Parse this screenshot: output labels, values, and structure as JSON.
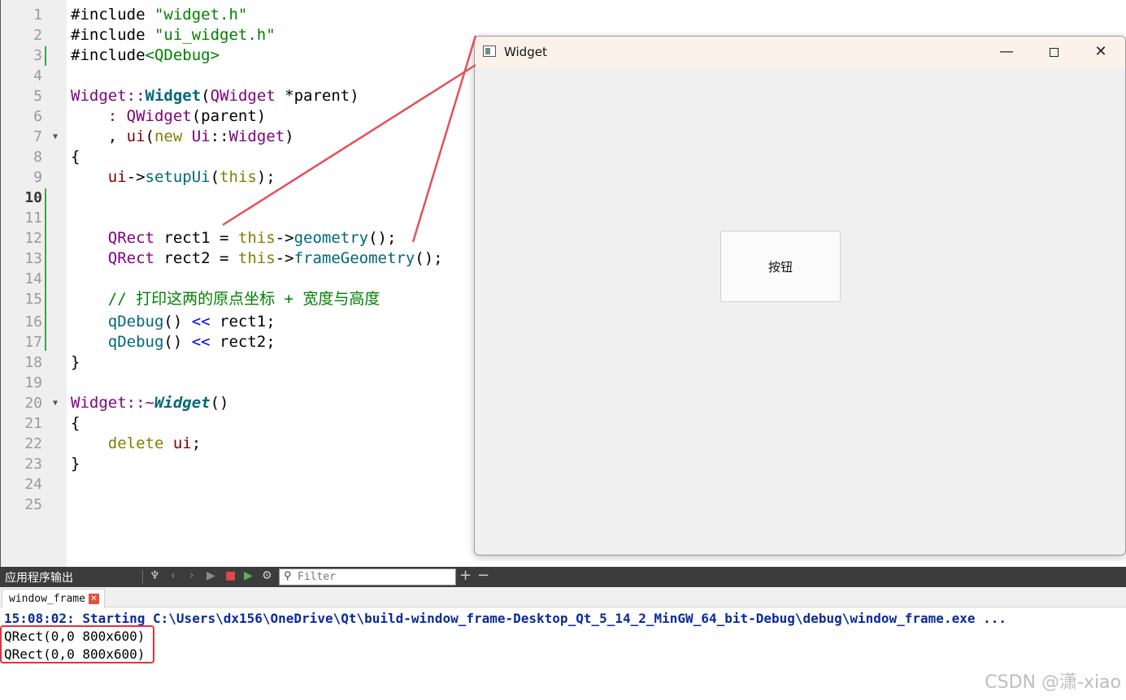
{
  "editor": {
    "line_numbers": [
      "1",
      "2",
      "3",
      "4",
      "5",
      "6",
      "7",
      "8",
      "9",
      "10",
      "11",
      "12",
      "13",
      "14",
      "15",
      "16",
      "17",
      "18",
      "19",
      "20",
      "21",
      "22",
      "23",
      "24",
      "25"
    ],
    "current_line": "10",
    "code": {
      "l1_kw": "#include",
      "l1_str": " \"widget.h\"",
      "l2_kw": "#include",
      "l2_str": " \"ui_widget.h\"",
      "l3_kw": "#include",
      "l3_str": "<QDebug>",
      "l5_a": "Widget",
      "l5_b": "::",
      "l5_c": "Widget",
      "l5_d": "(",
      "l5_e": "QWidget",
      "l5_f": " *parent)",
      "l6_a": "    : ",
      "l6_b": "QWidget",
      "l6_c": "(parent)",
      "l7_a": "    , ",
      "l7_b": "ui",
      "l7_c": "(",
      "l7_d": "new",
      "l7_e": " Ui",
      "l7_f": "::",
      "l7_g": "Widget",
      "l7_h": ")",
      "l8": "{",
      "l9_a": "    ui",
      "l9_b": "->",
      "l9_c": "setupUi",
      "l9_d": "(",
      "l9_e": "this",
      "l9_f": ");",
      "l12_a": "    QRect",
      "l12_b": " rect1 = ",
      "l12_c": "this",
      "l12_d": "->",
      "l12_e": "geometry",
      "l12_f": "();",
      "l13_a": "    QRect",
      "l13_b": " rect2 = ",
      "l13_c": "this",
      "l13_d": "->",
      "l13_e": "frameGeometry",
      "l13_f": "();",
      "l15": "    // 打印这两的原点坐标 + 宽度与高度",
      "l16_a": "    qDebug",
      "l16_b": "() ",
      "l16_c": "<<",
      "l16_d": " rect1;",
      "l17_a": "    qDebug",
      "l17_b": "() ",
      "l17_c": "<<",
      "l17_d": " rect2;",
      "l18": "}",
      "l20_a": "Widget",
      "l20_b": "::~",
      "l20_c": "Widget",
      "l20_d": "()",
      "l21": "{",
      "l22_a": "    delete",
      "l22_b": " ui",
      "l22_c": ";",
      "l23": "}"
    }
  },
  "qt_window": {
    "title": "Widget",
    "minimize_glyph": "—",
    "close_glyph": "✕",
    "button_label": "按钮"
  },
  "output_pane": {
    "title": "应用程序输出",
    "toolbar": {
      "clear_icon": "broom-icon",
      "prev_glyph": "‹",
      "next_glyph": "›",
      "run_glyph": "▶",
      "stop_glyph": "■",
      "debug_glyph": "▶",
      "settings_glyph": "⚙",
      "add_glyph": "+",
      "remove_glyph": "−"
    },
    "filter_placeholder": "Filter",
    "tab_label": "window_frame",
    "lines": {
      "start": "15:08:02: Starting C:\\Users\\dx156\\OneDrive\\Qt\\build-window_frame-Desktop_Qt_5_14_2_MinGW_64_bit-Debug\\debug\\window_frame.exe ...",
      "rect1": "QRect(0,0 800x600)",
      "rect2": "QRect(0,0 800x600)"
    }
  },
  "watermark": "CSDN @潇-xiao",
  "colors": {
    "keyword": "#808000",
    "string": "#008000",
    "type": "#800080",
    "function": "#00677c",
    "annotation": "#e5303b"
  }
}
